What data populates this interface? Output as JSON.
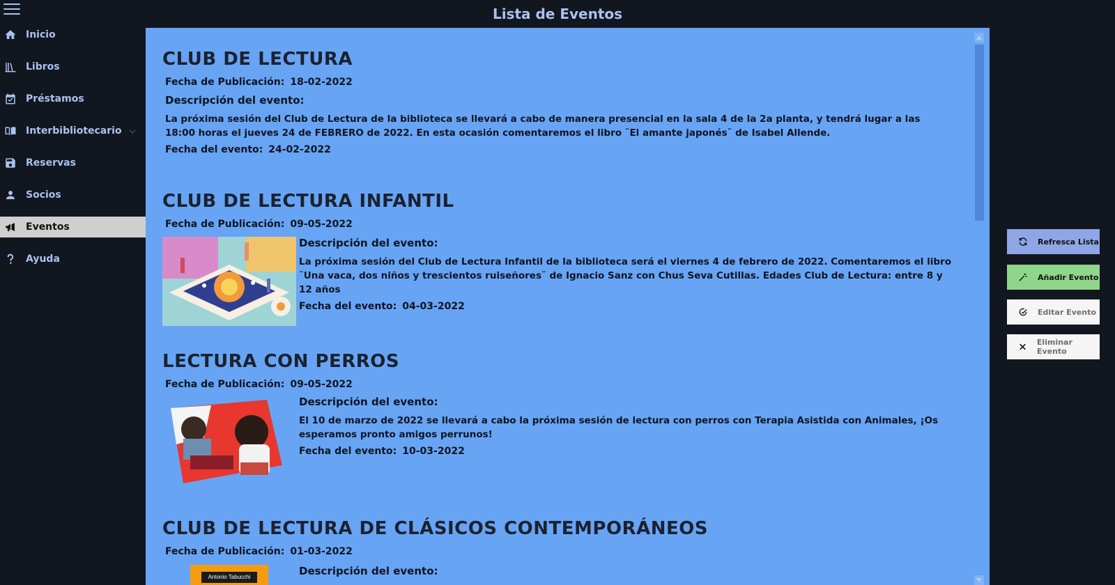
{
  "window": {
    "title": "Lista de Eventos"
  },
  "sidebar": {
    "items": [
      {
        "label": "Inicio",
        "icon": "home-icon"
      },
      {
        "label": "Libros",
        "icon": "books-icon"
      },
      {
        "label": "Préstamos",
        "icon": "calendar-check-icon"
      },
      {
        "label": "Interbibliotecario",
        "icon": "open-book-icon",
        "has_submenu": true
      },
      {
        "label": "Reservas",
        "icon": "save-icon"
      },
      {
        "label": "Socios",
        "icon": "person-icon"
      },
      {
        "label": "Eventos",
        "icon": "megaphone-icon",
        "active": true
      },
      {
        "label": "Ayuda",
        "icon": "question-icon"
      }
    ]
  },
  "events": [
    {
      "title": "CLUB DE LECTURA",
      "pub_label": "Fecha de Publicación:",
      "pub_date": "18-02-2022",
      "desc_label": "Descripción del evento:",
      "description": "La próxima sesión del Club de Lectura de la biblioteca se llevará a cabo de manera presencial en la sala 4 de la 2a planta, y tendrá lugar a las 18:00 horas el jueves 24 de FEBRERO de 2022. En esta ocasión comentaremos el libro ¨El amante japonés¨ de Isabel Allende.",
      "date_label": "Fecha del evento:",
      "event_date": "24-02-2022"
    },
    {
      "title": "CLUB DE LECTURA INFANTIL",
      "pub_label": "Fecha de Publicación:",
      "pub_date": "09-05-2022",
      "desc_label": "Descripción del evento:",
      "description": "La próxima sesión del Club de Lectura Infantil de la biblioteca será el viernes 4 de febrero de 2022. Comentaremos el libro ¨Una vaca, dos niños y trescientos ruiseñores¨ de Ignacio Sanz con Chus Seva Cutillas. Edades Club de Lectura: entre 8 y 12 años",
      "date_label": "Fecha del evento:",
      "event_date": "04-03-2022"
    },
    {
      "title": "LECTURA CON PERROS",
      "pub_label": "Fecha de Publicación:",
      "pub_date": "09-05-2022",
      "desc_label": "Descripción del evento:",
      "description": "El 10 de marzo de 2022 se llevará a cabo la próxima sesión de lectura con perros con Terapia Asistida con Animales, ¡Os esperamos pronto amigos perrunos!",
      "date_label": "Fecha del evento:",
      "event_date": "10-03-2022"
    },
    {
      "title": "CLUB DE LECTURA DE CLÁSICOS CONTEMPORÁNEOS",
      "pub_label": "Fecha de Publicación:",
      "pub_date": "01-03-2022",
      "desc_label": "Descripción del evento:",
      "book_cover_text": "Antonio Tabucchi"
    }
  ],
  "actions": {
    "refresh": "Refresca Lista",
    "add": "Añadir Evento",
    "edit": "Editar Evento",
    "delete": "Eliminar Evento"
  },
  "colors": {
    "background": "#12161f",
    "content": "#68a4f4",
    "accent_text": "#a9c2ef",
    "refresh_btn": "#8fa6e6",
    "add_btn": "#8fd58a",
    "disabled_btn": "#f5f5f5"
  }
}
